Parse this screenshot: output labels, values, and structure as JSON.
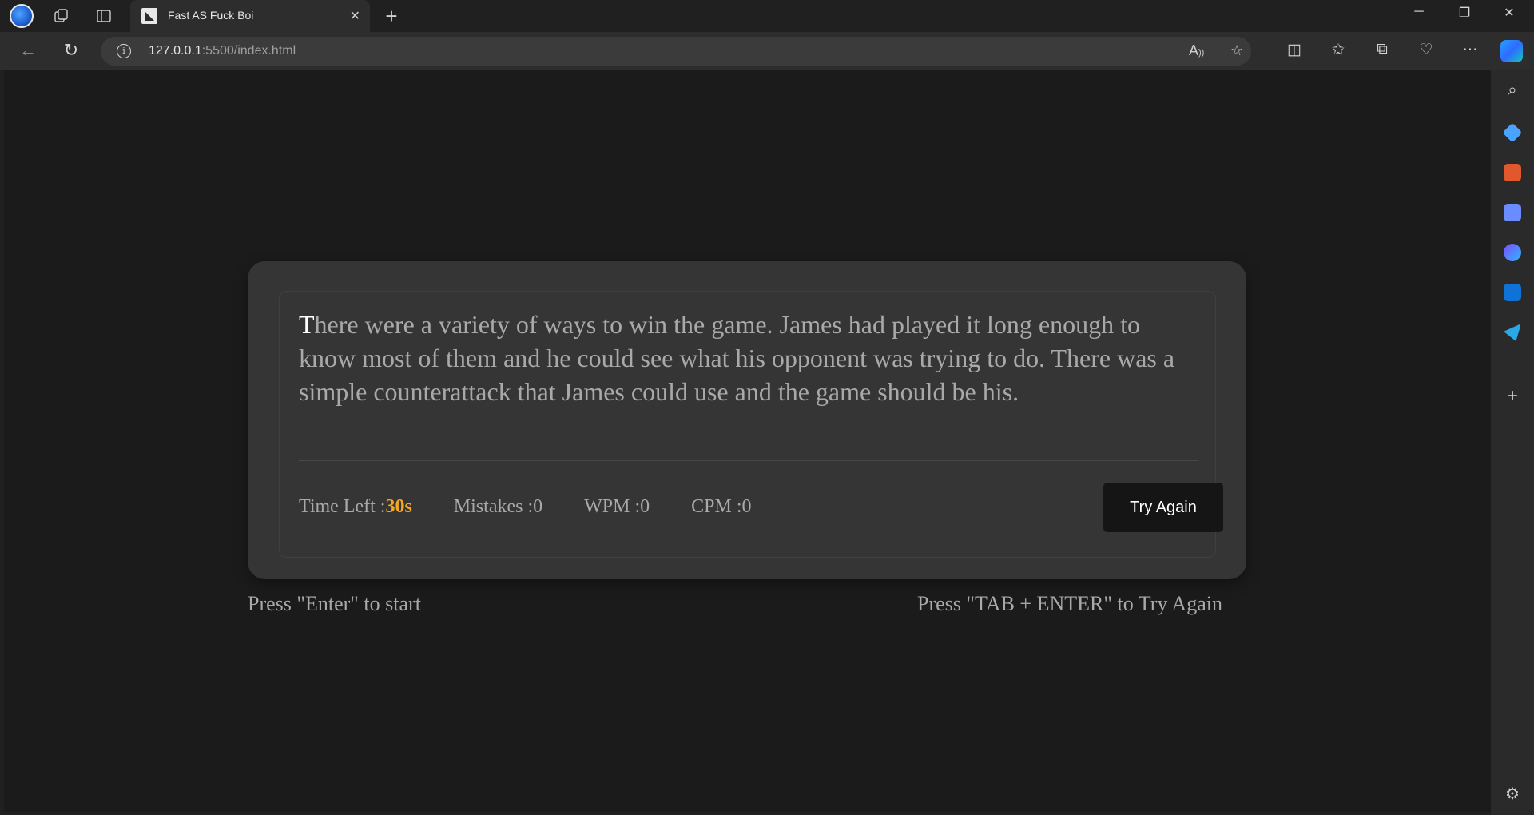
{
  "browser": {
    "tab_title": "Fast AS Fuck Boi",
    "url_host": "127.0.0.1",
    "url_path": ":5500/index.html"
  },
  "game": {
    "passage_first_char": "T",
    "passage_rest": "here were a variety of ways to win the game. James had played it long enough to know most of them and he could see what his opponent was trying to do. There was a simple counterattack that James could use and the game should be his.",
    "time_label": "Time Left :",
    "time_value": "30s",
    "mistakes_label": "Mistakes :",
    "mistakes_value": "0",
    "wpm_label": "WPM :",
    "wpm_value": "0",
    "cpm_label": "CPM :",
    "cpm_value": "0",
    "try_again_label": "Try Again"
  },
  "hints": {
    "start": "Press \"Enter\" to start",
    "retry": "Press \"TAB + ENTER\" to Try Again"
  },
  "icons": {
    "profile": "profile-avatar-icon",
    "workspaces": "workspaces-icon",
    "tab_actions": "vertical-tabs-icon",
    "new_tab": "plus-icon",
    "back": "back-arrow-icon",
    "reload": "reload-icon",
    "site_info": "info-icon",
    "read_aloud": "read-aloud-icon",
    "favorite": "star-icon",
    "split_screen": "split-screen-icon",
    "favorites": "favorites-icon",
    "collections": "collections-icon",
    "browser_essentials": "heart-pulse-icon",
    "more": "ellipsis-icon",
    "copilot": "copilot-icon",
    "settings": "gear-icon"
  },
  "colors": {
    "accent_time": "#f5a623",
    "card_bg": "#353535",
    "page_bg": "#1b1b1b",
    "button_bg": "#151515"
  }
}
